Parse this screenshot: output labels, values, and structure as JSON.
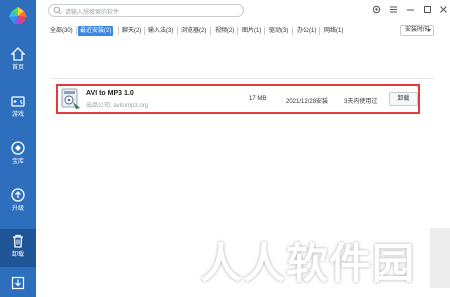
{
  "search": {
    "placeholder": "请输入想搜索的软件"
  },
  "sidebar": {
    "items": [
      {
        "label": "首页",
        "icon": "home-icon"
      },
      {
        "label": "游戏",
        "icon": "gamepad-icon"
      },
      {
        "label": "宝库",
        "icon": "treasure-icon"
      },
      {
        "label": "升级",
        "icon": "upgrade-icon"
      },
      {
        "label": "卸载",
        "icon": "trash-icon",
        "active": true
      },
      {
        "label": "",
        "icon": "download-icon"
      }
    ]
  },
  "tabs": [
    {
      "label": "全部(30)"
    },
    {
      "label": "最近安装(2)",
      "active": true
    },
    {
      "label": "聊天(2)"
    },
    {
      "label": "输入法(3)"
    },
    {
      "label": "浏览器(2)"
    },
    {
      "label": "视频(2)"
    },
    {
      "label": "图片(1)"
    },
    {
      "label": "驱动(3)"
    },
    {
      "label": "办公(1)"
    },
    {
      "label": "网络(1)"
    }
  ],
  "sort": {
    "label": "安装时间"
  },
  "app": {
    "name": "AVI to MP3 1.0",
    "publisher": "出品公司: avitomp3.org",
    "size": "17 MB",
    "date": "2021/12/28安装",
    "usage": "3天内使用过",
    "uninstall_label": "卸载"
  },
  "watermark": {
    "text": "人人软件园"
  },
  "colors": {
    "sidebar": "#2d6fbd",
    "accent": "#3b86e0",
    "highlight": "#e23b3b"
  }
}
